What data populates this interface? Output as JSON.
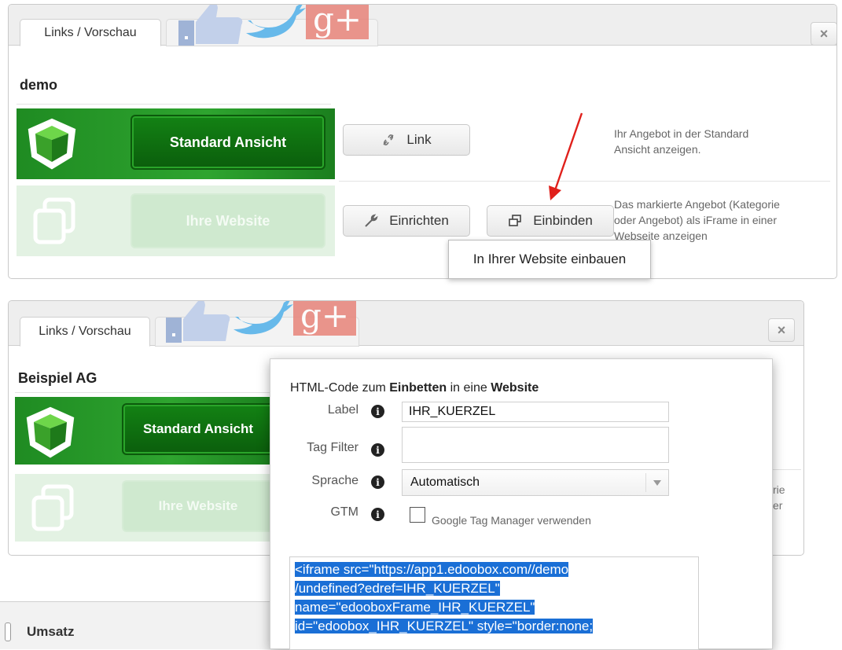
{
  "top_panel": {
    "tab_label": "Links / Vorschau",
    "close_symbol": "×",
    "title": "demo",
    "row1": {
      "button_label": "Standard Ansicht",
      "link_label": "Link",
      "desc_line1": "Ihr Angebot in der Standard",
      "desc_line2": "Ansicht anzeigen."
    },
    "row2": {
      "button_label": "Ihre Website",
      "setup_label": "Einrichten",
      "embed_label": "Einbinden",
      "desc_line1": "Das markierte Angebot (Kategorie",
      "desc_line2": "oder Angebot) als iFrame in einer",
      "desc_line3": "Webseite anzeigen"
    },
    "tooltip": "In Ihrer Website einbauen"
  },
  "bottom_panel": {
    "tab_label": "Links / Vorschau",
    "close_symbol": "×",
    "title": "Beispiel AG",
    "row1_button_label": "Standard Ansicht",
    "row2_button_label": "Ihre Website",
    "peek_text_1": "rie",
    "peek_text_2": "er"
  },
  "dialog": {
    "heading_prefix": "HTML-Code zum ",
    "heading_bold1": "Einbetten",
    "heading_mid": " in eine ",
    "heading_bold2": "Website",
    "fields": {
      "label": {
        "label": "Label",
        "value": "IHR_KUERZEL"
      },
      "tag_filter": {
        "label": "Tag Filter",
        "value": ""
      },
      "sprache": {
        "label": "Sprache",
        "value": "Automatisch"
      },
      "gtm": {
        "label": "GTM",
        "checkbox_label": "Google Tag Manager verwenden",
        "checked": false
      }
    },
    "code_lines": [
      "<iframe src=\"https://app1.edoobox.com//demo",
      "/undefined?edref=IHR_KUERZEL\"",
      "name=\"edooboxFrame_IHR_KUERZEL\"",
      "id=\"edoobox_IHR_KUERZEL\" style=\"border:none;"
    ]
  },
  "footer": {
    "label": "Umsatz"
  },
  "colors": {
    "green": "#1f8b22",
    "selection": "#1a6fd6",
    "arrow": "#e0201b"
  },
  "icons": [
    "link-icon",
    "wrench-icon",
    "embed-icon",
    "close-icon",
    "info-icon",
    "dropdown-arrow-icon",
    "cube-icon",
    "website-icon",
    "facebook-thumb-icon",
    "twitter-bird-icon",
    "google-plus-icon"
  ]
}
